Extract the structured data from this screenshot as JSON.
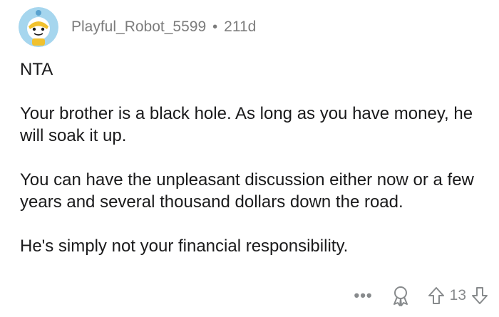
{
  "comment": {
    "author": "Playful_Robot_5599",
    "separator": "•",
    "age": "211d",
    "paragraphs": [
      "NTA",
      "Your brother is a black hole. As long as you have money, he will soak it up.",
      "You can have the unpleasant discussion either now or a few years and several thousand dollars down the road.",
      "He's simply not your financial responsibility."
    ],
    "more_label": "•••",
    "score": "13"
  },
  "colors": {
    "avatar_bg": "#a6d6ee",
    "avatar_ring": "#ffffff",
    "meta_text": "#7c7c7c",
    "action_gray": "#878a8c"
  },
  "icons": {
    "more": "more-icon",
    "award": "award-icon",
    "upvote": "upvote-arrow-icon",
    "downvote": "downvote-arrow-icon"
  }
}
